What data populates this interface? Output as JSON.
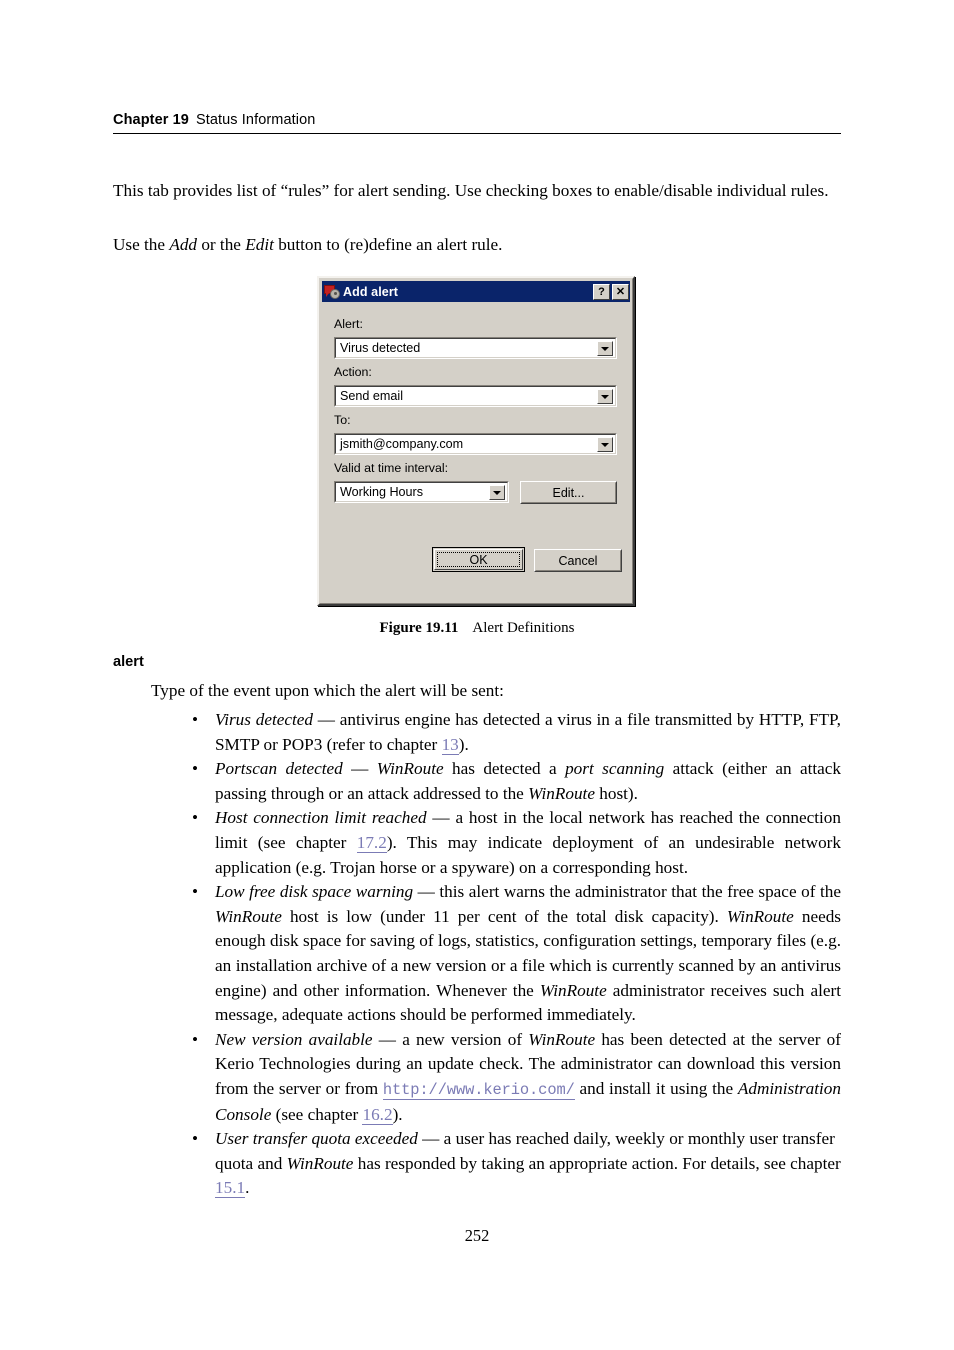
{
  "header": {
    "chapter": "Chapter 19",
    "title": "Status Information"
  },
  "intro": {
    "paragraph1_a": "This tab provides list of ",
    "paragraph1_quote": "“rules”",
    "paragraph1_b": " for alert sending. Use checking boxes to enable/disable individual rules.",
    "paragraph2_a": "Use the ",
    "paragraph2_add": "Add",
    "paragraph2_b": " or the ",
    "paragraph2_edit": "Edit",
    "paragraph2_c": " button to (re)define an alert rule."
  },
  "dialog": {
    "title": "Add alert",
    "icon": "alert-gear-icon",
    "help_button": "?",
    "close_button": "✕",
    "fields": {
      "alert_label": "Alert:",
      "alert_value": "Virus detected",
      "action_label": "Action:",
      "action_value": "Send email",
      "to_label": "To:",
      "to_value": "jsmith@company.com",
      "interval_label": "Valid at time interval:",
      "interval_value": "Working Hours",
      "edit_button": "Edit..."
    },
    "ok_button": "OK",
    "cancel_button": "Cancel",
    "titlebar_color": "#0a246a",
    "face_color": "#d4d0c8"
  },
  "figure": {
    "number": "Figure 19.11",
    "caption": "Alert Definitions"
  },
  "section": {
    "heading": "alert",
    "intro": "Type of the event upon which the alert will be sent:"
  },
  "bullets": [
    {
      "term": "Virus detected",
      "parts": [
        {
          "t": "text",
          "v": " — antivirus engine has detected a virus in a file transmitted by HTTP, FTP, SMTP or POP3 (refer to chapter "
        },
        {
          "t": "xref",
          "v": "13"
        },
        {
          "t": "text",
          "v": ")."
        }
      ]
    },
    {
      "term": "Portscan detected",
      "parts": [
        {
          "t": "text",
          "v": " — "
        },
        {
          "t": "em",
          "v": "WinRoute"
        },
        {
          "t": "text",
          "v": " has detected a  "
        },
        {
          "t": "em",
          "v": "port scanning"
        },
        {
          "t": "text",
          "v": " attack (either an attack passing through or an attack addressed to the "
        },
        {
          "t": "em",
          "v": "WinRoute"
        },
        {
          "t": "text",
          "v": " host)."
        }
      ]
    },
    {
      "term": "Host connection limit reached",
      "parts": [
        {
          "t": "text",
          "v": " — a host in the local network has reached the connection limit (see chapter "
        },
        {
          "t": "xref",
          "v": "17.2"
        },
        {
          "t": "text",
          "v": "). This may indicate deployment of an undesirable network application (e.g. Trojan horse or a spyware) on a corresponding host."
        }
      ]
    },
    {
      "term": "Low free disk space warning",
      "parts": [
        {
          "t": "text",
          "v": " — this alert warns the administrator that the free space of the "
        },
        {
          "t": "em",
          "v": "WinRoute"
        },
        {
          "t": "text",
          "v": " host is low (under 11 per cent of the total disk capacity). "
        },
        {
          "t": "em",
          "v": "WinRoute"
        },
        {
          "t": "text",
          "v": " needs enough disk space for saving of logs, statistics, configuration settings, temporary files (e.g. an installation archive of a new version or a file which is currently scanned by an antivirus engine) and other information. Whenever the "
        },
        {
          "t": "em",
          "v": "WinRoute"
        },
        {
          "t": "text",
          "v": " administrator receives such alert message, adequate actions should be performed immediately."
        }
      ]
    },
    {
      "term": "New version available",
      "parts": [
        {
          "t": "text",
          "v": " — a new version of "
        },
        {
          "t": "em",
          "v": "WinRoute"
        },
        {
          "t": "text",
          "v": " has been detected at the server of Kerio Technologies during an update check.  The administrator can download this version from the server or from "
        },
        {
          "t": "url",
          "v": "http://www.kerio.com/"
        },
        {
          "t": "text",
          "v": " and install it using the "
        },
        {
          "t": "em",
          "v": "Administration Console"
        },
        {
          "t": "text",
          "v": " (see chapter "
        },
        {
          "t": "xref",
          "v": "16.2"
        },
        {
          "t": "text",
          "v": ")."
        }
      ]
    },
    {
      "term": "User transfer quota exceeded",
      "parts": [
        {
          "t": "text",
          "v": " — a user has reached daily, weekly or monthly user transfer quota and "
        },
        {
          "t": "em",
          "v": "WinRoute"
        },
        {
          "t": "text",
          "v": " has responded by taking an appropriate action. For details, see chapter "
        },
        {
          "t": "xref",
          "v": "15.1"
        },
        {
          "t": "text",
          "v": "."
        }
      ]
    }
  ],
  "folio": "252"
}
